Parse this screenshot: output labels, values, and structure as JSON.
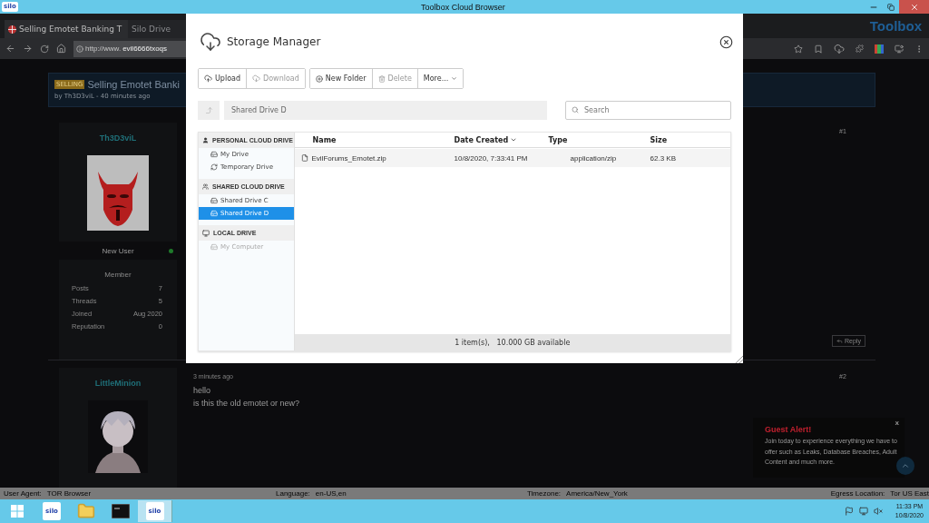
{
  "title_bar": {
    "logo": "silo",
    "title": "Toolbox Cloud Browser"
  },
  "browser": {
    "tabs": [
      {
        "label": "Selling Emotet Banking T",
        "selected": true
      },
      {
        "label": "Silo Drive",
        "selected": false
      }
    ],
    "brand": "Toolbox",
    "url_prefix": "http://www.",
    "url_host": "evil6666txoqs"
  },
  "thread": {
    "tag": "SELLING",
    "title": "Selling Emotet Banki",
    "byline": "by Th3D3viL - 40 minutes ago"
  },
  "posts": [
    {
      "author": "Th3D3viL",
      "rank": "New User",
      "online": true,
      "group": "Member",
      "stats": [
        {
          "label": "Posts",
          "value": "7"
        },
        {
          "label": "Threads",
          "value": "5"
        },
        {
          "label": "Joined",
          "value": "Aug 2020"
        },
        {
          "label": "Reputation",
          "value": "0"
        }
      ],
      "number": "#1",
      "reply": "Reply"
    },
    {
      "author": "LittleMinion",
      "time": "3 minutes ago",
      "lines": [
        "hello",
        "is this the old emotet or new?"
      ],
      "number": "#2"
    }
  ],
  "guest_alert": {
    "title": "Guest Alert!",
    "text": "Join today to experience everything we have to offer such as Leaks, Database Breaches, Adult Content and much more.",
    "close": "x"
  },
  "storage_manager": {
    "title": "Storage Manager",
    "toolbar": [
      [
        {
          "kind": "upload",
          "label": "Upload",
          "disabled": false
        },
        {
          "kind": "download",
          "label": "Download",
          "disabled": true
        }
      ],
      [
        {
          "kind": "new-folder",
          "label": "New Folder",
          "disabled": false
        },
        {
          "kind": "delete",
          "label": "Delete",
          "disabled": true
        },
        {
          "kind": "more",
          "label": "More...",
          "disabled": false
        }
      ]
    ],
    "path": "Shared Drive D",
    "search": {
      "placeholder": "Search"
    },
    "sidebar": [
      {
        "kind": "personal",
        "label": "PERSONAL CLOUD DRIVE",
        "items": [
          {
            "kind": "drive",
            "label": "My Drive",
            "selected": false,
            "disabled": false
          },
          {
            "kind": "temporary",
            "label": "Temporary Drive",
            "selected": false,
            "disabled": false
          }
        ]
      },
      {
        "kind": "shared",
        "label": "SHARED CLOUD DRIVE",
        "items": [
          {
            "kind": "drive",
            "label": "Shared Drive C",
            "selected": false,
            "disabled": false
          },
          {
            "kind": "drive",
            "label": "Shared Drive D",
            "selected": true,
            "disabled": false
          }
        ]
      },
      {
        "kind": "local",
        "label": "LOCAL DRIVE",
        "items": [
          {
            "kind": "drive",
            "label": "My Computer",
            "selected": false,
            "disabled": true
          }
        ]
      }
    ],
    "columns": [
      {
        "label": "Name",
        "sorted": false
      },
      {
        "label": "Date Created",
        "sorted": true
      },
      {
        "label": "Type",
        "sorted": false
      },
      {
        "label": "Size",
        "sorted": false
      }
    ],
    "files": [
      {
        "name": "EvilForums_Emotet.zip",
        "date": "10/8/2020, 7:33:41 PM",
        "type": "application/zip",
        "size": "62.3 KB"
      }
    ],
    "footer": "1 item(s),   10.000 GB available"
  },
  "status_strip": [
    {
      "label": "User Agent:",
      "value": "TOR Browser"
    },
    {
      "label": "Language:",
      "value": "en-US,en"
    },
    {
      "label": "Timezone:",
      "value": "America/New_York"
    },
    {
      "label": "Egress Location:",
      "value": "Tor US East"
    }
  ],
  "taskbar": {
    "apps": [
      {
        "kind": "start",
        "active": false
      },
      {
        "kind": "silo",
        "label": "silo",
        "active": false
      },
      {
        "kind": "folder",
        "active": false
      },
      {
        "kind": "terminal",
        "active": false
      },
      {
        "kind": "silo",
        "label": "silo",
        "active": true
      }
    ],
    "time": "11:33 PM",
    "date": "10/8/2020"
  }
}
